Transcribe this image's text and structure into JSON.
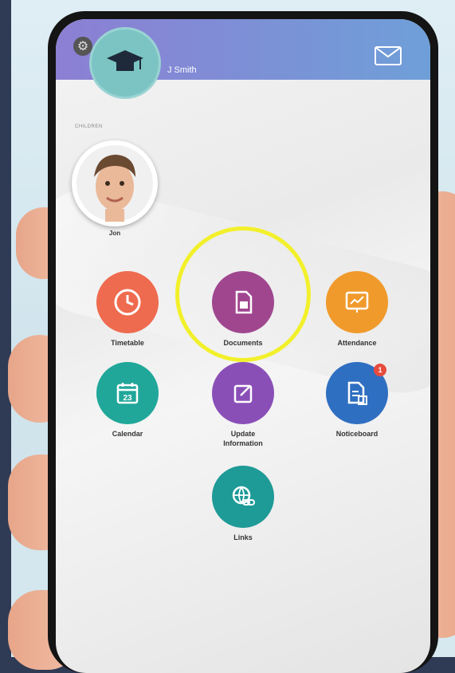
{
  "header": {
    "user_name": "J Smith",
    "section_label": "CHILDREN"
  },
  "children": [
    {
      "name": "Jon"
    }
  ],
  "tiles": [
    {
      "label": "Timetable",
      "color": "#ef6b4f",
      "icon": "clock-icon"
    },
    {
      "label": "Documents",
      "color": "#a0468f",
      "icon": "document-icon"
    },
    {
      "label": "Attendance",
      "color": "#f09a2c",
      "icon": "chart-icon"
    },
    {
      "label": "Calendar",
      "color": "#20a79a",
      "icon": "calendar-icon",
      "day": "23"
    },
    {
      "label": "Update Information",
      "color": "#8a4fb7",
      "icon": "edit-icon"
    },
    {
      "label": "Noticeboard",
      "color": "#2f6fc1",
      "icon": "noticeboard-icon",
      "badge": "1"
    },
    {
      "label": "Links",
      "color": "#1e9a97",
      "icon": "link-icon"
    }
  ],
  "colors": {
    "header_start": "#8c7fd4",
    "header_end": "#6f9fd8",
    "highlight": "#f2f02a"
  }
}
